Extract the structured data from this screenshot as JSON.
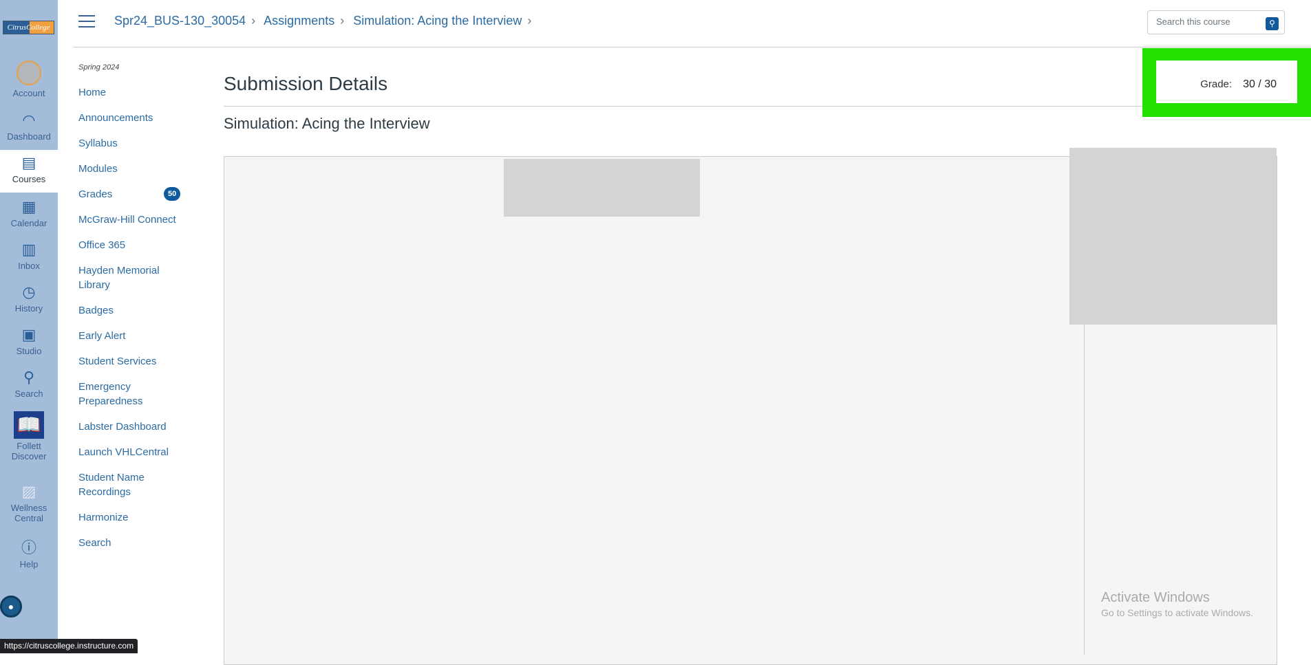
{
  "global_nav": {
    "logo": "CitrusCollege",
    "items": [
      {
        "label": "Account",
        "icon": "avatar"
      },
      {
        "label": "Dashboard",
        "icon": "dashboard-icon"
      },
      {
        "label": "Courses",
        "icon": "courses-icon",
        "active": true
      },
      {
        "label": "Calendar",
        "icon": "calendar-icon"
      },
      {
        "label": "Inbox",
        "icon": "inbox-icon"
      },
      {
        "label": "History",
        "icon": "history-icon"
      },
      {
        "label": "Studio",
        "icon": "studio-icon"
      },
      {
        "label": "Search",
        "icon": "search-icon"
      },
      {
        "label": "Follett Discover",
        "icon": "book-icon"
      },
      {
        "label": "Wellness Central",
        "icon": "clipboard-icon"
      },
      {
        "label": "Help",
        "icon": "help-icon"
      }
    ]
  },
  "header": {
    "breadcrumb": [
      "Spr24_BUS-130_30054",
      "Assignments",
      "Simulation: Acing the Interview"
    ],
    "search_placeholder": "Search this course"
  },
  "course_nav": {
    "term": "Spring 2024",
    "items": [
      "Home",
      "Announcements",
      "Syllabus",
      "Modules",
      "Grades",
      "McGraw-Hill Connect",
      "Office 365",
      "Hayden Memorial Library",
      "Badges",
      "Early Alert",
      "Student Services",
      "Emergency Preparedness",
      "Labster Dashboard",
      "Launch VHLCentral",
      "Student Name Recordings",
      "Harmonize",
      "Search"
    ],
    "grades_badge": "50"
  },
  "main": {
    "title": "Submission Details",
    "assignment": "Simulation: Acing the Interview",
    "grade_label": "Grade:",
    "grade_value": "30 / 30"
  },
  "overlay": {
    "activate_title": "Activate Windows",
    "activate_sub": "Go to Settings to activate Windows.",
    "status_url": "https://citruscollege.instructure.com"
  },
  "colors": {
    "link": "#2a6ba3",
    "highlight": "#22e000",
    "nav_bg": "#a3bcd9"
  }
}
